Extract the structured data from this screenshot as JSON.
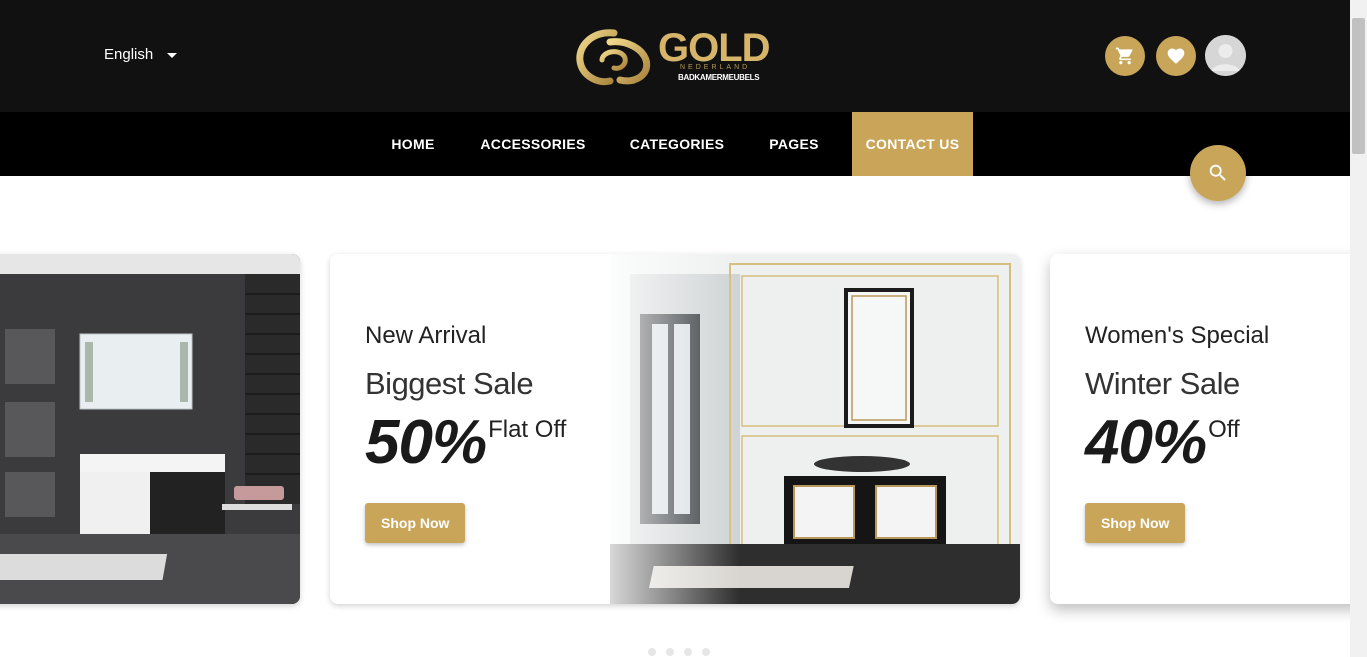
{
  "header": {
    "language": "English",
    "logo": {
      "word": "GOLD",
      "sub1": "NEDERLAND",
      "sub2": "BADKAMERMEUBELS"
    },
    "icons": [
      "cart-icon",
      "heart-icon",
      "user-avatar"
    ]
  },
  "nav": {
    "items": [
      {
        "label": "HOME"
      },
      {
        "label": "ACCESSORIES"
      },
      {
        "label": "CATEGORIES"
      },
      {
        "label": "PAGES"
      },
      {
        "label": "CONTACT US",
        "active": true
      }
    ]
  },
  "slides": [
    {
      "eyebrow": "New Arrival",
      "title": "Biggest Sale",
      "big": "50%",
      "suffix": "Flat Off",
      "button": "Shop Now"
    },
    {
      "eyebrow": "Women's Special",
      "title": "Winter Sale",
      "big": "40%",
      "suffix": "Off",
      "button": "Shop Now"
    }
  ],
  "colors": {
    "gold": "#c9a55a",
    "topbar": "#111111",
    "navbar": "#000000"
  }
}
